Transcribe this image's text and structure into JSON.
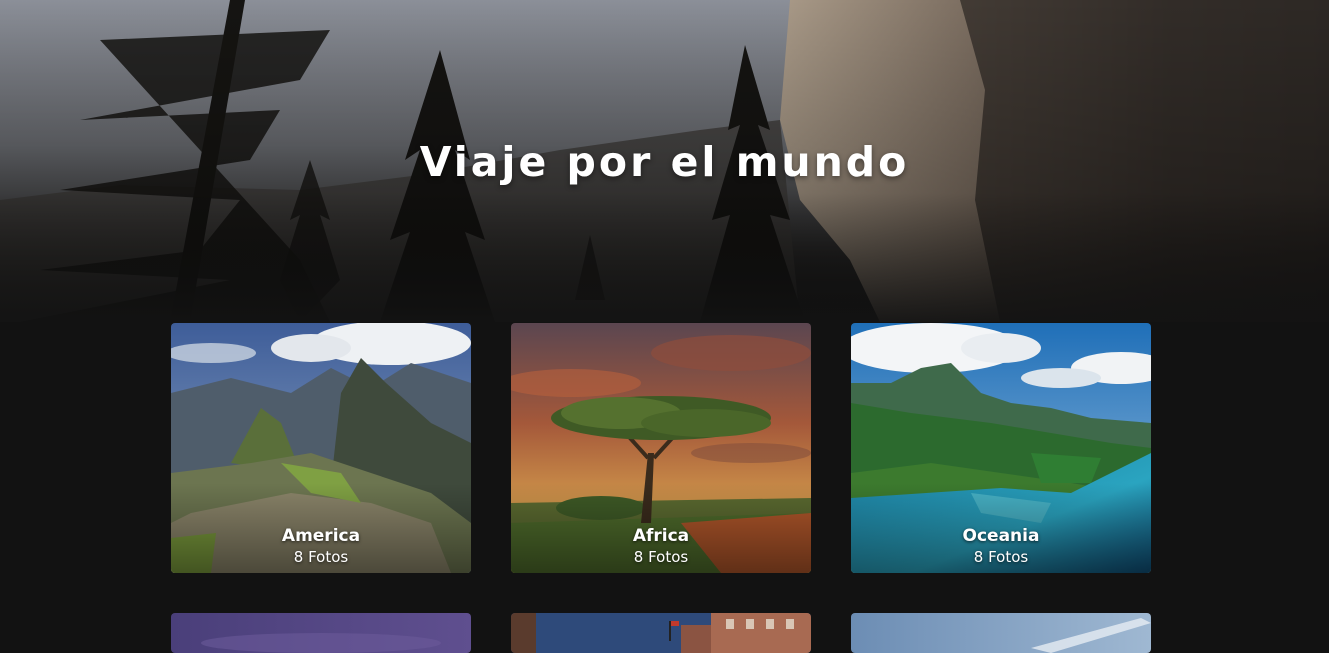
{
  "hero": {
    "title": "Viaje por el mundo"
  },
  "gallery": {
    "cards": [
      {
        "name": "America",
        "count": "8 Fotos",
        "image": "machu-picchu-landscape"
      },
      {
        "name": "Africa",
        "count": "8 Fotos",
        "image": "acacia-tree-sunset"
      },
      {
        "name": "Oceania",
        "count": "8 Fotos",
        "image": "tropical-island-lagoon"
      }
    ],
    "partial_cards": [
      {
        "image": "purple-night-sky"
      },
      {
        "image": "city-buildings-flag"
      },
      {
        "image": "blue-sky-clouds"
      }
    ]
  },
  "colors": {
    "page_background": "#121212",
    "text": "#ffffff"
  }
}
